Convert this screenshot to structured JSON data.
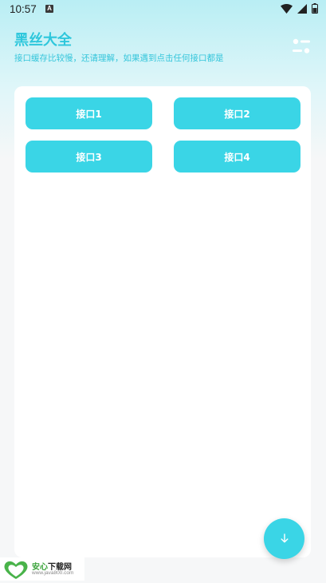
{
  "status_bar": {
    "time": "10:57",
    "notification_badge": "A",
    "icons": [
      "wifi-icon",
      "signal-icon",
      "battery-icon"
    ]
  },
  "header": {
    "title": "黑丝大全",
    "subtitle": "接口缓存比较慢，还请理解，如果遇到点击任何接口都是",
    "menu_icon": "settings-sliders-icon"
  },
  "api_buttons": [
    {
      "label": "接口1"
    },
    {
      "label": "接口2"
    },
    {
      "label": "接口3"
    },
    {
      "label": "接口4"
    }
  ],
  "fab": {
    "icon": "arrow-down-icon"
  },
  "watermark": {
    "name_green": "安心",
    "name_rest": "下载网",
    "url": "www.java800.com",
    "logo_text": "安心下载"
  },
  "colors": {
    "accent": "#3ad5e6",
    "title": "#2ec7dc",
    "header_gradient_top": "#b9eef4",
    "background": "#f6f7f8",
    "card": "#ffffff"
  }
}
